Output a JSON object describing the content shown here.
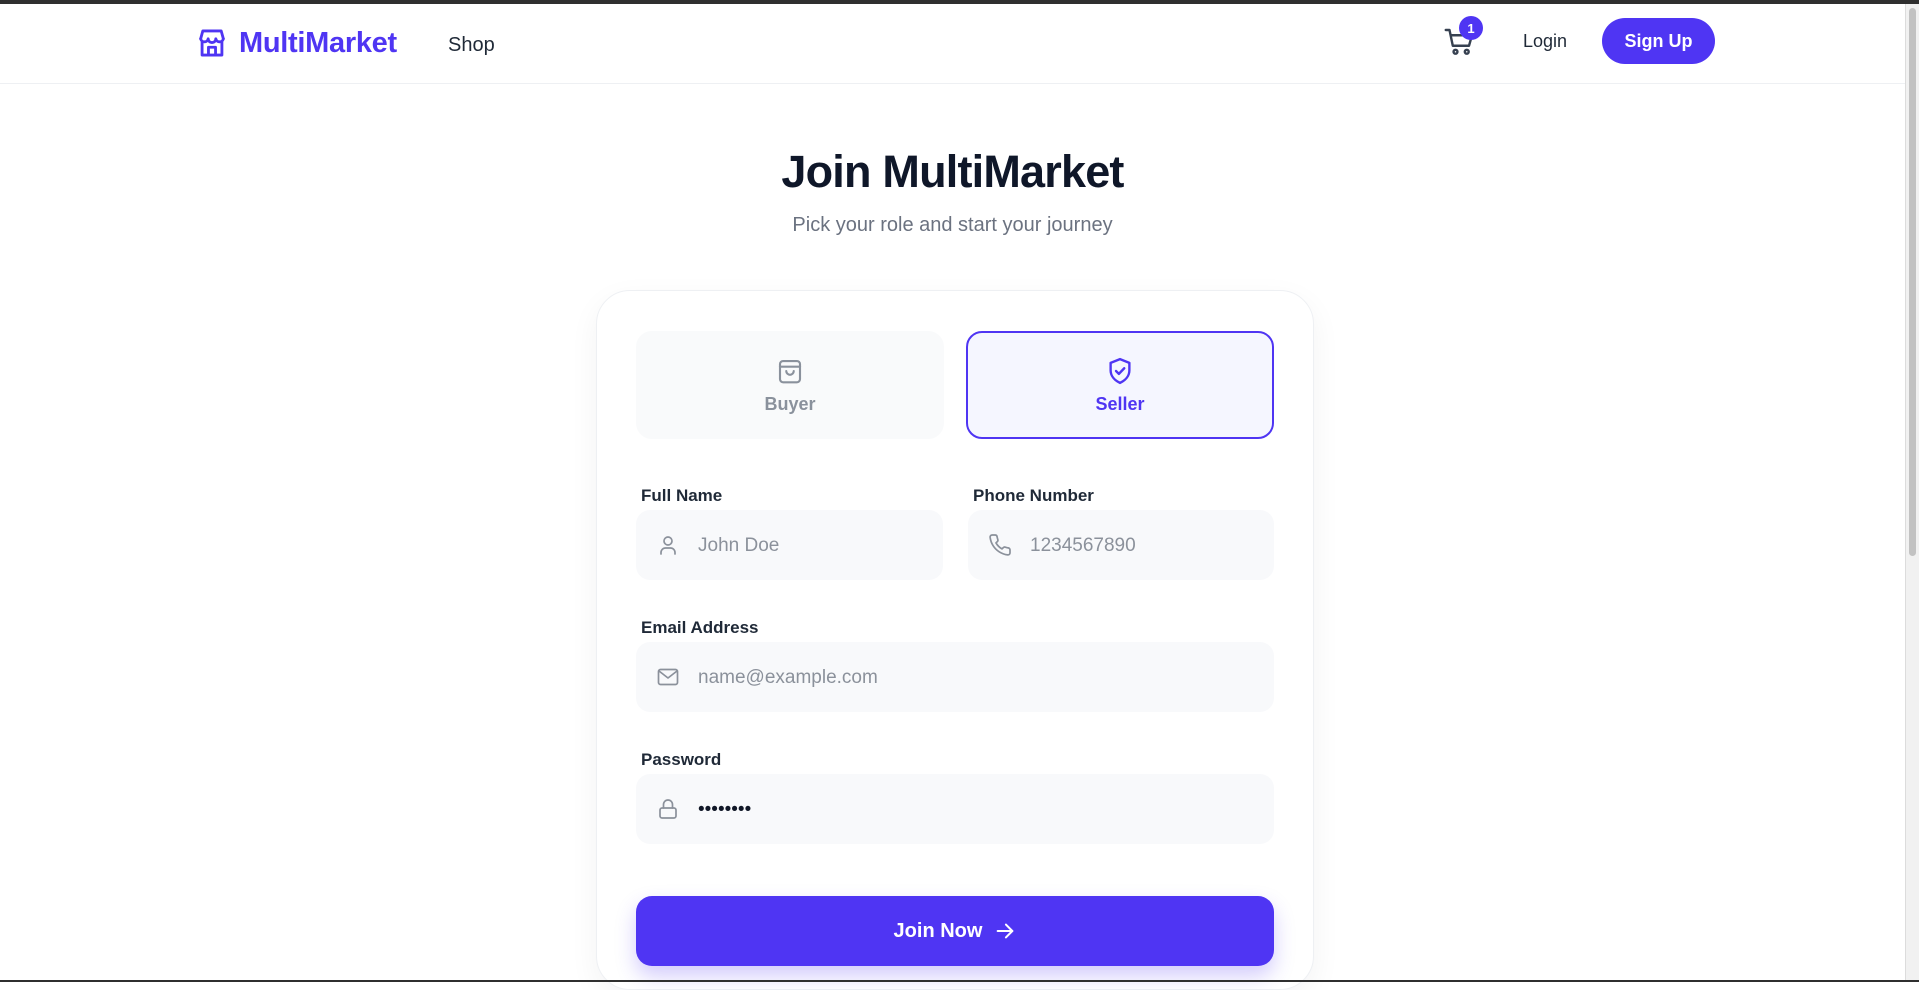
{
  "header": {
    "brand": "MultiMarket",
    "nav_shop": "Shop",
    "cart_count": "1",
    "login": "Login",
    "signup": "Sign Up"
  },
  "page": {
    "title": "Join MultiMarket",
    "subtitle": "Pick your role and start your journey"
  },
  "roles": {
    "buyer": "Buyer",
    "seller": "Seller",
    "selected": "seller"
  },
  "form": {
    "full_name": {
      "label": "Full Name",
      "placeholder": "John Doe"
    },
    "phone": {
      "label": "Phone Number",
      "placeholder": "1234567890"
    },
    "email": {
      "label": "Email Address",
      "placeholder": "name@example.com"
    },
    "password": {
      "label": "Password",
      "value": "password"
    },
    "submit": "Join Now"
  },
  "colors": {
    "accent": "#4f35f3",
    "text_dark": "#0f1729",
    "muted": "#6b7280"
  },
  "icons": [
    "storefront-icon",
    "cart-icon",
    "shopping-bag-icon",
    "shield-check-icon",
    "user-icon",
    "phone-icon",
    "mail-icon",
    "lock-icon",
    "arrow-right-icon"
  ]
}
